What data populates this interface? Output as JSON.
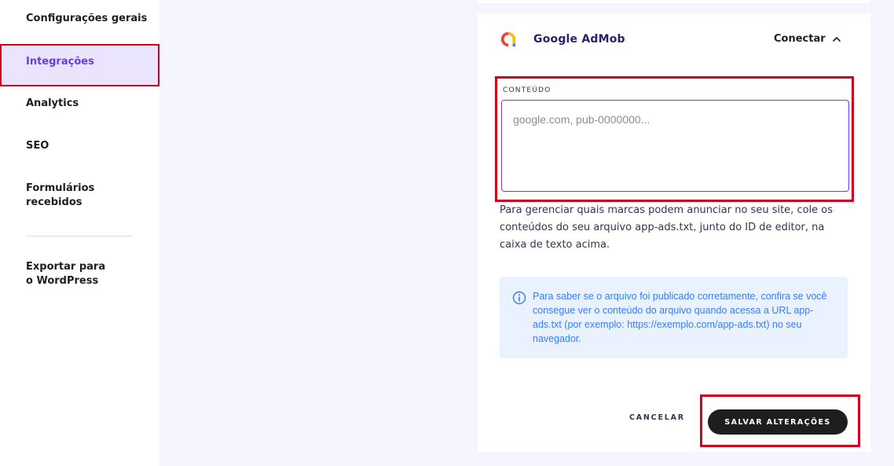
{
  "sidebar": {
    "items": [
      {
        "label": "Configurações gerais"
      },
      {
        "label": "Integrações"
      },
      {
        "label": "Analytics"
      },
      {
        "label": "SEO"
      },
      {
        "label": "Formulários recebidos"
      },
      {
        "label": "Exportar para o WordPress"
      }
    ]
  },
  "integration": {
    "title": "Google AdMob",
    "connect_label": "Conectar",
    "field_label": "CONTEÚDO",
    "field_value": "",
    "field_placeholder": "google.com, pub-0000000...",
    "help_text": "Para gerenciar quais marcas podem anunciar no seu site, cole os conteúdos do seu arquivo app-ads.txt, junto do ID de editor, na caixa de texto acima.",
    "info_text": "Para saber se o arquivo foi publicado corretamente, confira se você consegue ver o conteúdo do arquivo quando acessa a URL app-ads.txt (por exemplo: https://exemplo.com/app-ads.txt) no seu navegador.",
    "info_icon": "info-circle-icon"
  },
  "actions": {
    "cancel_label": "CANCELAR",
    "save_label": "SALVAR ALTERAÇÕES"
  },
  "colors": {
    "accent": "#673de6",
    "active_bg": "#ebe4ff",
    "highlight_border": "#d0021b",
    "info_bg": "#eaf2ff",
    "info_text": "#357df9",
    "primary_button": "#1d1e20"
  }
}
